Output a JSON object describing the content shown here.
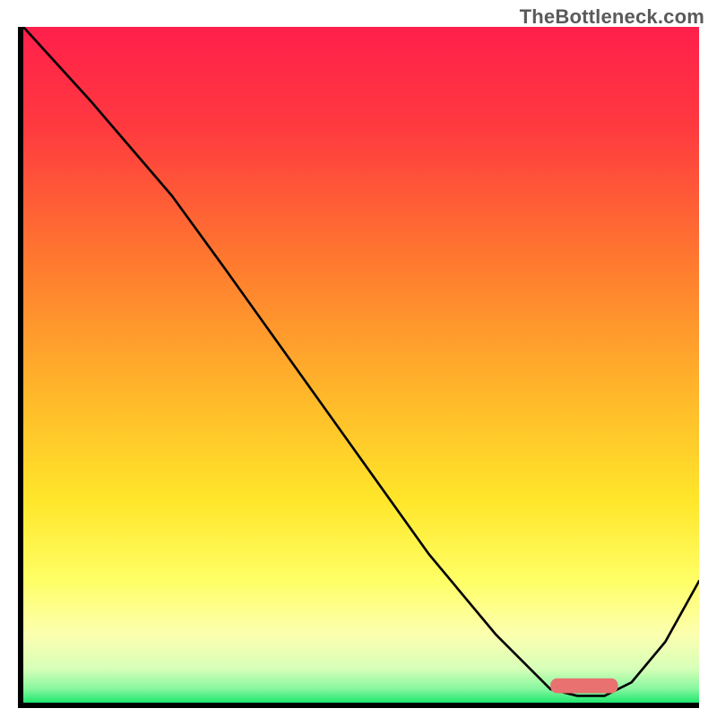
{
  "watermark": "TheBottleneck.com",
  "colors": {
    "border": "#000000",
    "curve": "#000000",
    "marker": "#e9716f",
    "gradient_top": "#ff1f4b",
    "gradient_bottom": "#1ee86e"
  },
  "chart_data": {
    "type": "line",
    "title": "",
    "xlabel": "",
    "ylabel": "",
    "xlim": [
      0,
      100
    ],
    "ylim": [
      0,
      100
    ],
    "grid": false,
    "legend": false,
    "series": [
      {
        "name": "bottleneck-curve",
        "x": [
          0,
          10,
          22,
          30,
          40,
          50,
          60,
          70,
          78,
          82,
          86,
          90,
          95,
          100
        ],
        "y": [
          100,
          89,
          75,
          64,
          50,
          36,
          22,
          10,
          2,
          1,
          1,
          3,
          9,
          18
        ]
      }
    ],
    "annotations": [
      {
        "name": "optimal-range-marker",
        "shape": "rounded-rect",
        "x_start": 78,
        "x_end": 88,
        "y": 2.5,
        "height": 2.2
      }
    ]
  }
}
